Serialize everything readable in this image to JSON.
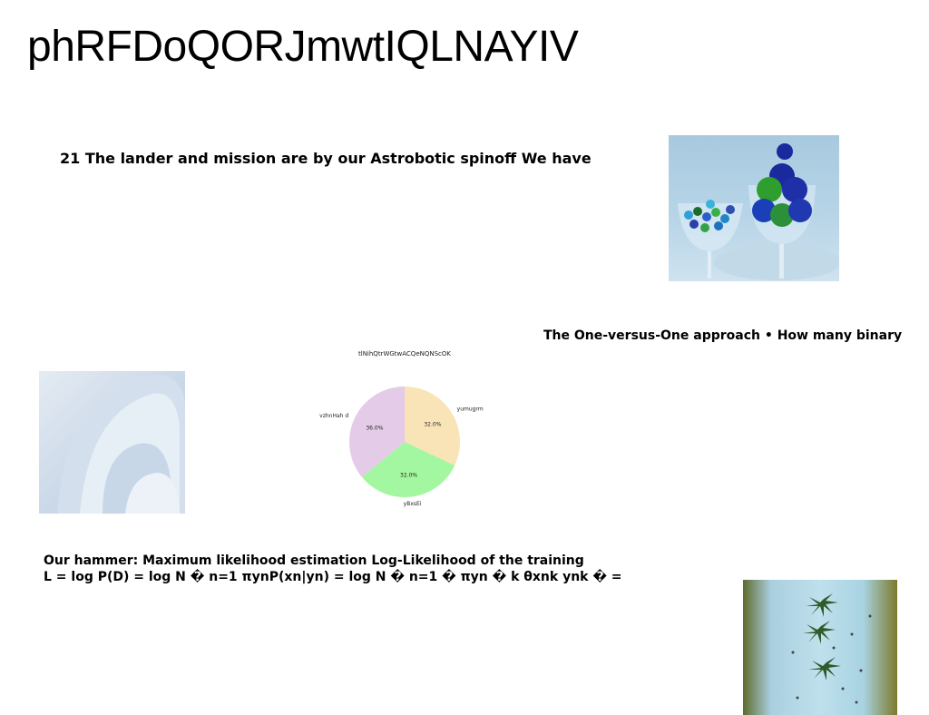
{
  "page": {
    "title": "phRFDoQORJmwtIQLNAYIV"
  },
  "text_blocks": {
    "lander": "21 The lander and mission are by our Astrobotic spinoff We have",
    "one_vs_one": "The One-versus-One approach • How many binary",
    "mle_line1": "Our hammer: Maximum likelihood estimation Log-Likelihood of the training",
    "mle_line2": "L = log P(D) = log N � n=1 πynP(xn|yn) = log N � n=1 � πyn � k θxnk ynk � ="
  },
  "images": {
    "candy_photo": "Glass bowls with wrapped candies and colored eggs",
    "abstract_photo": "Abstract curved shapes",
    "beach_photo": "Aerial view of a beach with palm trees"
  },
  "chart_data": {
    "type": "pie",
    "title": "tlNihQtrWGtwACQeNQNScOK",
    "labels": [
      "yumugrm",
      "yBxsEi",
      "vzhnHah d"
    ],
    "values": [
      32.0,
      32.0,
      36.0
    ],
    "value_labels": [
      "32.0%",
      "32.0%",
      "36.0%"
    ],
    "colors": [
      "#f9e4b7",
      "#a3f7a0",
      "#e4cbe7"
    ]
  }
}
